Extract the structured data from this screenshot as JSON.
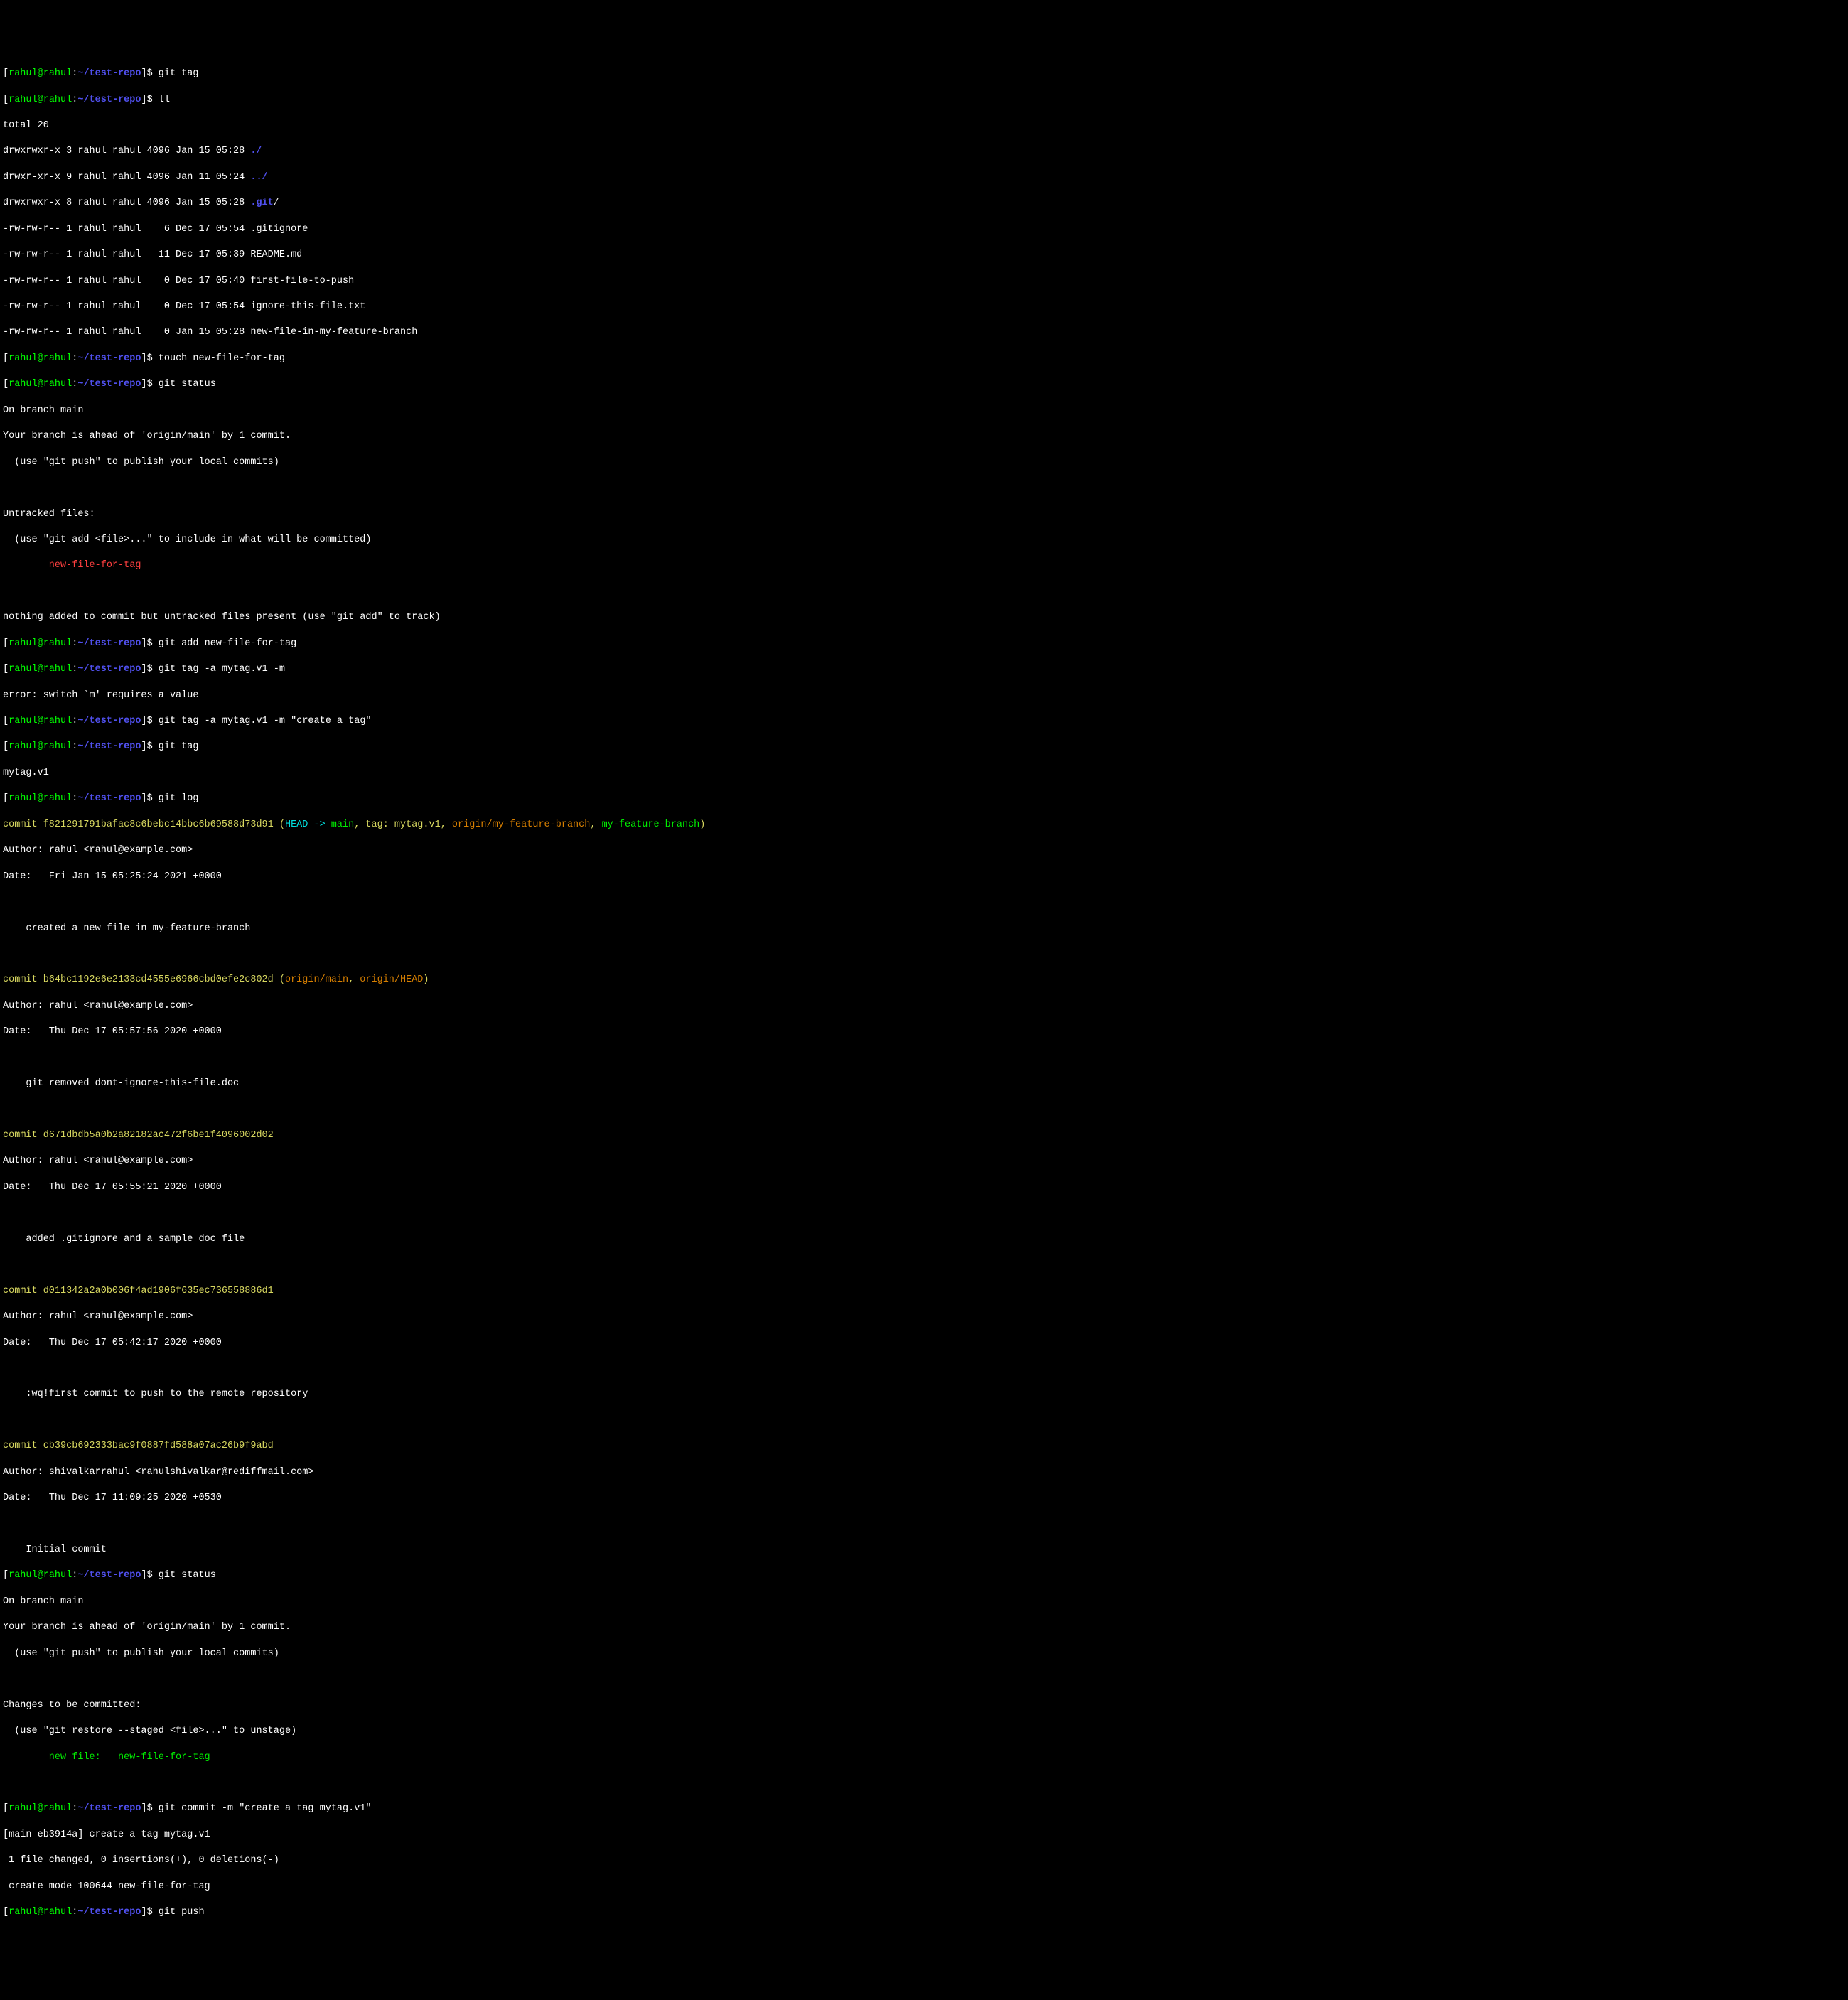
{
  "prompt": {
    "bracket_open": "[",
    "user_host": "rahul@rahul",
    "sep": ":",
    "path": "~/test-repo",
    "bracket_close": "]",
    "dollar": "$ "
  },
  "cmd": {
    "git_tag": "git tag",
    "ll": "ll",
    "touch": "touch new-file-for-tag",
    "git_status": "git status",
    "git_add": "git add new-file-for-tag",
    "git_tag_err": "git tag -a mytag.v1 -m",
    "git_tag_ok": "git tag -a mytag.v1 -m \"create a tag\"",
    "git_tag2": "git tag",
    "git_log": "git log",
    "git_status2": "git status",
    "git_commit": "git commit -m \"create a tag mytag.v1\"",
    "git_push": "git push"
  },
  "ll": {
    "total": "total 20",
    "l1_perm": "drwxrwxr-x 3 rahul rahul 4096 Jan 15 05:28 ",
    "l1_name": "./",
    "l2_perm": "drwxr-xr-x 9 rahul rahul 4096 Jan 11 05:24 ",
    "l2_name": "../",
    "l3_perm": "drwxrwxr-x 8 rahul rahul 4096 Jan 15 05:28 ",
    "l3_name": ".git",
    "l3_slash": "/",
    "l4": "-rw-rw-r-- 1 rahul rahul    6 Dec 17 05:54 .gitignore",
    "l5": "-rw-rw-r-- 1 rahul rahul   11 Dec 17 05:39 README.md",
    "l6": "-rw-rw-r-- 1 rahul rahul    0 Dec 17 05:40 first-file-to-push",
    "l7": "-rw-rw-r-- 1 rahul rahul    0 Dec 17 05:54 ignore-this-file.txt",
    "l8": "-rw-rw-r-- 1 rahul rahul    0 Jan 15 05:28 new-file-in-my-feature-branch"
  },
  "status1": {
    "branch": "On branch main",
    "ahead": "Your branch is ahead of 'origin/main' by 1 commit.",
    "push_hint": "  (use \"git push\" to publish your local commits)",
    "untracked_hdr": "Untracked files:",
    "add_hint": "  (use \"git add <file>...\" to include in what will be committed)",
    "file": "        new-file-for-tag",
    "nothing": "nothing added to commit but untracked files present (use \"git add\" to track)"
  },
  "tag_err": "error: switch `m' requires a value",
  "tag_out": "mytag.v1",
  "log": {
    "c1_commit": "commit f821291791bafac8c6bebc14bbc6b69588d73d91",
    "c1_paren_open": " (",
    "c1_head": "HEAD -> ",
    "c1_main": "main",
    "c1_sep1": ", ",
    "c1_tag": "tag: mytag.v1",
    "c1_sep2": ", ",
    "c1_remote": "origin/my-feature-branch",
    "c1_sep3": ", ",
    "c1_local": "my-feature-branch",
    "c1_paren_close": ")",
    "c1_author": "Author: rahul <rahul@example.com>",
    "c1_date": "Date:   Fri Jan 15 05:25:24 2021 +0000",
    "c1_msg": "    created a new file in my-feature-branch",
    "c2_commit": "commit b64bc1192e6e2133cd4555e6966cbd0efe2c802d",
    "c2_paren_open": " (",
    "c2_om": "origin/main",
    "c2_sep": ", ",
    "c2_oh": "origin/HEAD",
    "c2_paren_close": ")",
    "c2_author": "Author: rahul <rahul@example.com>",
    "c2_date": "Date:   Thu Dec 17 05:57:56 2020 +0000",
    "c2_msg": "    git removed dont-ignore-this-file.doc",
    "c3_commit": "commit d671dbdb5a0b2a82182ac472f6be1f4096002d02",
    "c3_author": "Author: rahul <rahul@example.com>",
    "c3_date": "Date:   Thu Dec 17 05:55:21 2020 +0000",
    "c3_msg": "    added .gitignore and a sample doc file",
    "c4_commit": "commit d011342a2a0b006f4ad1906f635ec736558886d1",
    "c4_author": "Author: rahul <rahul@example.com>",
    "c4_date": "Date:   Thu Dec 17 05:42:17 2020 +0000",
    "c4_msg": "    :wq!first commit to push to the remote repository",
    "c5_commit": "commit cb39cb692333bac9f0887fd588a07ac26b9f9abd",
    "c5_author": "Author: shivalkarrahul <rahulshivalkar@rediffmail.com>",
    "c5_date": "Date:   Thu Dec 17 11:09:25 2020 +0530",
    "c5_msg": "    Initial commit"
  },
  "status2": {
    "branch": "On branch main",
    "ahead": "Your branch is ahead of 'origin/main' by 1 commit.",
    "push_hint": "  (use \"git push\" to publish your local commits)",
    "changes": "Changes to be committed:",
    "unstage": "  (use \"git restore --staged <file>...\" to unstage)",
    "newfile": "        new file:   new-file-for-tag"
  },
  "commit_out": {
    "l1": "[main eb3914a] create a tag mytag.v1",
    "l2": " 1 file changed, 0 insertions(+), 0 deletions(-)",
    "l3": " create mode 100644 new-file-for-tag"
  }
}
